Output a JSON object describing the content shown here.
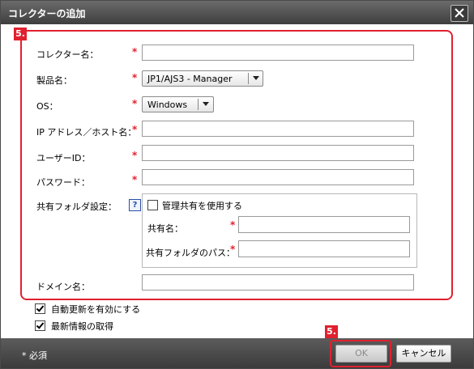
{
  "dialog": {
    "title": "コレクターの追加",
    "close_icon": "close-icon"
  },
  "callouts": {
    "form": "5.",
    "ok": "5."
  },
  "form": {
    "collector_name": {
      "label": "コレクター名：",
      "value": ""
    },
    "product_name": {
      "label": "製品名：",
      "selected": "JP1/AJS3 - Manager"
    },
    "os": {
      "label": "OS：",
      "selected": "Windows"
    },
    "ip_host": {
      "label": "IP アドレス／ホスト名：",
      "value": ""
    },
    "user_id": {
      "label": "ユーザーID：",
      "value": ""
    },
    "password": {
      "label": "パスワード：",
      "value": ""
    },
    "shared_folder": {
      "label": "共有フォルダ設定：",
      "help_icon": "?",
      "use_admin_share": {
        "label": "管理共有を使用する",
        "checked": false
      },
      "share_name": {
        "label": "共有名：",
        "value": ""
      },
      "share_path": {
        "label": "共有フォルダのパス：",
        "value": ""
      }
    },
    "domain_name": {
      "label": "ドメイン名：",
      "value": ""
    },
    "required_mark": "*"
  },
  "options": {
    "auto_update": {
      "label": "自動更新を有効にする",
      "checked": true
    },
    "fetch_latest": {
      "label": "最新情報の取得",
      "checked": true
    }
  },
  "footer": {
    "required_note": "* 必須",
    "ok_label": "OK",
    "cancel_label": "キャンセル"
  },
  "colors": {
    "accent_red": "#e0212f",
    "titlebar": "#4a4a4a"
  }
}
